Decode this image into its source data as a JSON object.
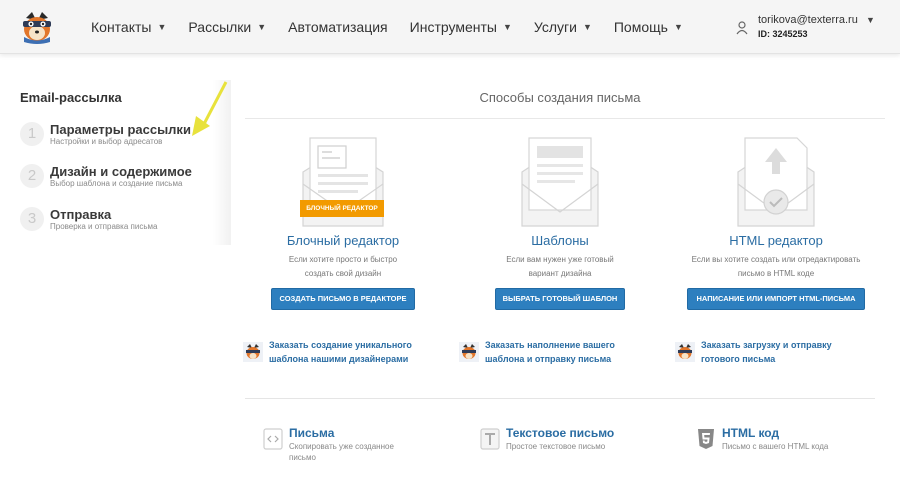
{
  "nav": {
    "logo_icon": "fox-mascot-logo",
    "items": [
      {
        "label": "Контакты",
        "has_dropdown": true
      },
      {
        "label": "Рассылки",
        "has_dropdown": true
      },
      {
        "label": "Автоматизация",
        "has_dropdown": false
      },
      {
        "label": "Инструменты",
        "has_dropdown": true
      },
      {
        "label": "Услуги",
        "has_dropdown": true
      },
      {
        "label": "Помощь",
        "has_dropdown": true
      }
    ],
    "user": {
      "email": "torikova@texterra.ru",
      "id_text": "ID: 3245253"
    }
  },
  "sidebar": {
    "title": "Email-рассылка",
    "steps": [
      {
        "num": "1",
        "title": "Параметры рассылки",
        "subtitle": "Настройки и выбор адресатов"
      },
      {
        "num": "2",
        "title": "Дизайн и содержимое",
        "subtitle": "Выбор шаблона и создание письма"
      },
      {
        "num": "3",
        "title": "Отправка",
        "subtitle": "Проверка и отправка письма"
      }
    ]
  },
  "main": {
    "section_title": "Способы создания письма",
    "cards": [
      {
        "badge": "Блочный редактор",
        "title": "Блочный редактор",
        "desc_line1": "Если хотите просто и быстро",
        "desc_line2": "создать свой дизайн",
        "button": "Создать письмо в редакторе",
        "order_line1": "Заказать создание уникального",
        "order_line2": "шаблона нашими дизайнерами"
      },
      {
        "title": "Шаблоны",
        "desc_line1": "Если вам нужен уже готовый",
        "desc_line2": "вариант дизайна",
        "button": "Выбрать готовый шаблон",
        "order_line1": "Заказать наполнение вашего",
        "order_line2": "шаблона и отправку письма"
      },
      {
        "title": "HTML редактор",
        "desc_line1": "Если вы хотите создать или отредактировать",
        "desc_line2": "письмо в HTML коде",
        "button": "Написание или импорт HTML-письма",
        "order_line1": "Заказать загрузку и отправку",
        "order_line2": "готового письма"
      }
    ],
    "items": [
      {
        "icon": "code-icon",
        "title": "Письма",
        "subtitle": "Скопировать уже созданное письмо"
      },
      {
        "icon": "text-t-icon",
        "title": "Текстовое письмо",
        "subtitle": "Простое текстовое письмо"
      },
      {
        "icon": "html5-icon",
        "title": "HTML код",
        "subtitle": "Письмо с вашего HTML кода"
      }
    ]
  },
  "colors": {
    "accent_blue": "#2d7fbf",
    "link_blue": "#2b6da3",
    "badge_orange": "#f29a00",
    "annotation_arrow": "#e8e23c"
  }
}
